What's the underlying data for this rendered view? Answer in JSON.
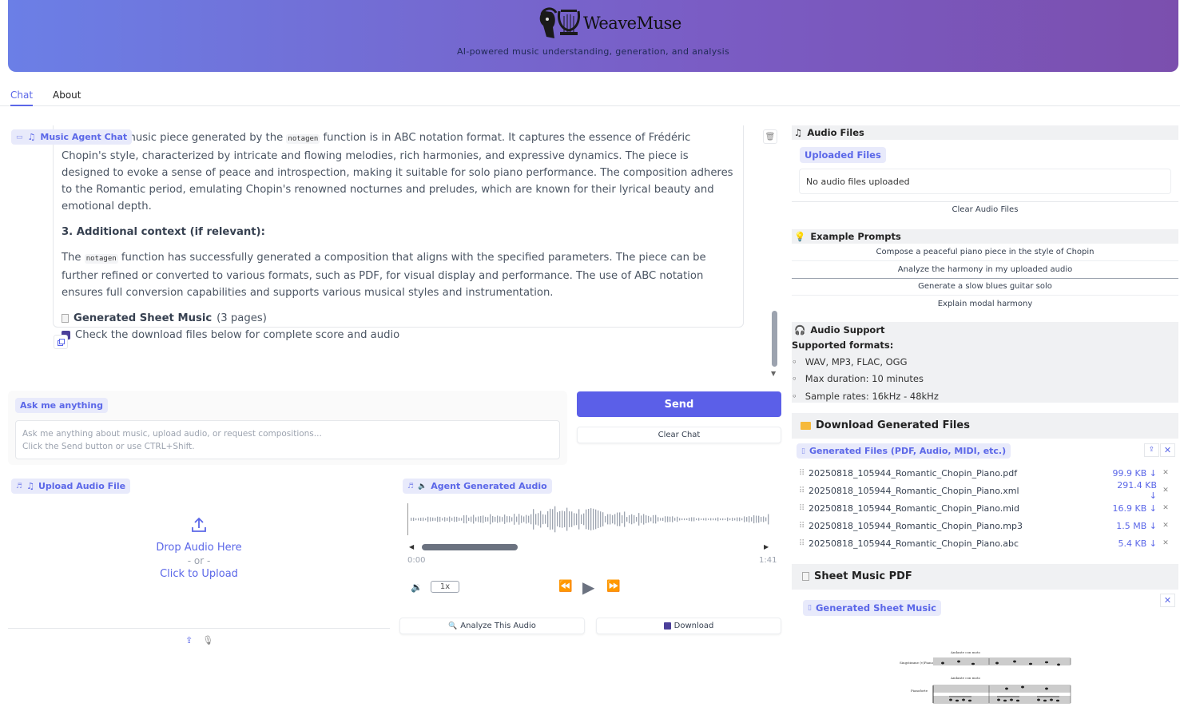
{
  "header": {
    "app_name": "WeaveMuse",
    "subtitle": "AI-powered music understanding, generation, and analysis"
  },
  "tabs": [
    {
      "label": "Chat",
      "active": true
    },
    {
      "label": "About",
      "active": false
    }
  ],
  "chat": {
    "label": "Music Agent Chat",
    "para1_pre": "music piece generated by the ",
    "para1_code": "notagen",
    "para1_post": " function is in ABC notation format. It captures the essence of Frédéric Chopin's style, characterized by intricate and flowing melodies, rich harmonies, and expressive dynamics. The piece is designed to evoke a sense of peace and introspection, making it suitable for solo piano performance. The composition adheres to the Romantic period, emulating Chopin's renowned nocturnes and preludes, which are known for their lyrical beauty and emotional depth.",
    "heading3": "3. Additional context (if relevant):",
    "para2_pre": "The ",
    "para2_code": "notagen",
    "para2_post": " function has successfully generated a composition that aligns with the specified parameters. The piece can be further refined or converted to various formats, such as PDF, for visual display and performance. The use of ABC notation ensures full conversion capabilities and supports various musical styles and instrumentation.",
    "sheet_title": "Generated Sheet Music",
    "sheet_pages": "(3 pages)",
    "download_note": "Check the download files below for complete score and audio"
  },
  "input": {
    "label": "Ask me anything",
    "placeholder": "Ask me anything about music, upload audio, or request compositions...\n Click the Send button or use CTRL+Shift."
  },
  "buttons": {
    "send": "Send",
    "clear_chat": "Clear Chat",
    "analyze_audio": "Analyze This Audio",
    "download": "Download"
  },
  "upload": {
    "label": "Upload Audio File",
    "drop": "Drop Audio Here",
    "or": "- or -",
    "click": "Click to Upload"
  },
  "agent_audio": {
    "label": "Agent Generated Audio",
    "time_current": "0:00",
    "time_total": "1:41",
    "speed": "1x",
    "progress": 0.0
  },
  "audio_files": {
    "title": "Audio Files",
    "uploaded_label": "Uploaded Files",
    "empty": "No audio files uploaded",
    "clear": "Clear Audio Files"
  },
  "example_prompts": {
    "title": "Example Prompts",
    "items": [
      "Compose a peaceful piano piece in the style of Chopin",
      "Analyze the harmony in my uploaded audio",
      "Generate a slow blues guitar solo",
      "Explain modal harmony"
    ]
  },
  "audio_support": {
    "title": "Audio Support",
    "formats_heading": "Supported formats:",
    "items": [
      "WAV, MP3, FLAC, OGG",
      "Max duration: 10 minutes",
      "Sample rates: 16kHz - 48kHz"
    ]
  },
  "downloads": {
    "title": "Download Generated Files",
    "label": "Generated Files (PDF, Audio, MIDI, etc.)",
    "files": [
      {
        "name": "20250818_105944_Romantic_Chopin_Piano.pdf",
        "size": "99.9 KB ↓"
      },
      {
        "name": "20250818_105944_Romantic_Chopin_Piano.xml",
        "size": "291.4 KB ↓"
      },
      {
        "name": "20250818_105944_Romantic_Chopin_Piano.mid",
        "size": "16.9 KB ↓"
      },
      {
        "name": "20250818_105944_Romantic_Chopin_Piano.mp3",
        "size": "1.5 MB ↓"
      },
      {
        "name": "20250818_105944_Romantic_Chopin_Piano.abc",
        "size": "5.4 KB ↓"
      }
    ]
  },
  "sheet_pdf": {
    "title": "Sheet Music PDF",
    "label": "Generated Sheet Music",
    "tempo_marking": "Andante con moto",
    "staff1_label": "Singstimme (v)Piano",
    "staff2_label": "Pianoforte"
  },
  "colors": {
    "accent": "#5b5fe8",
    "header_start": "#6b7fe6",
    "header_end": "#7b4fae"
  }
}
